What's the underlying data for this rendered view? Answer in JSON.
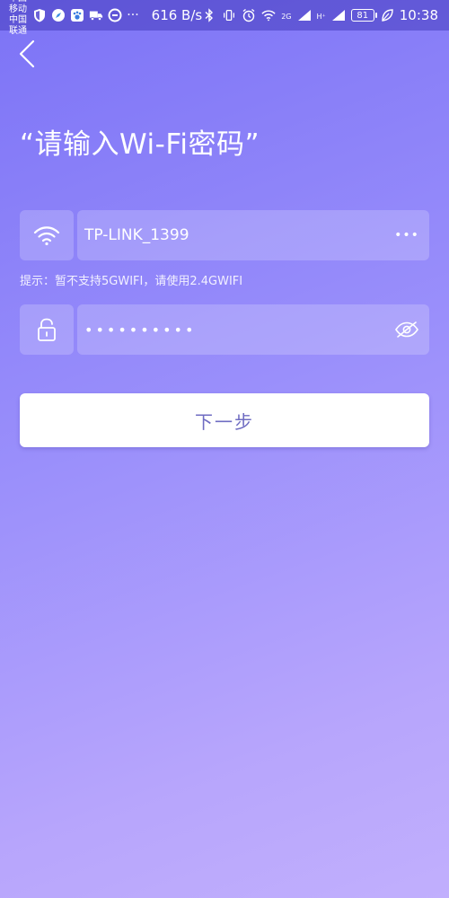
{
  "status_bar": {
    "carrier_1": "中国移动",
    "carrier_2": "中国联通",
    "more": "···",
    "speed": "616 B/s",
    "net_2g": "2G",
    "net_h": "H⁺",
    "battery": "81",
    "time": "10:38"
  },
  "title": "“请输入Wi-Fi密码”",
  "wifi_field": {
    "ssid": "TP-LINK_1399",
    "more": "•••"
  },
  "hint": "提示：暂不支持5GWIFI，请使用2.4GWIFI",
  "password_field": {
    "masked_value": "••••••••••"
  },
  "next_button": {
    "label": "下一步"
  },
  "icons": {
    "back": "chevron-left-icon",
    "wifi": "wifi-icon",
    "lock": "lock-icon",
    "eye": "eye-hidden-icon"
  }
}
